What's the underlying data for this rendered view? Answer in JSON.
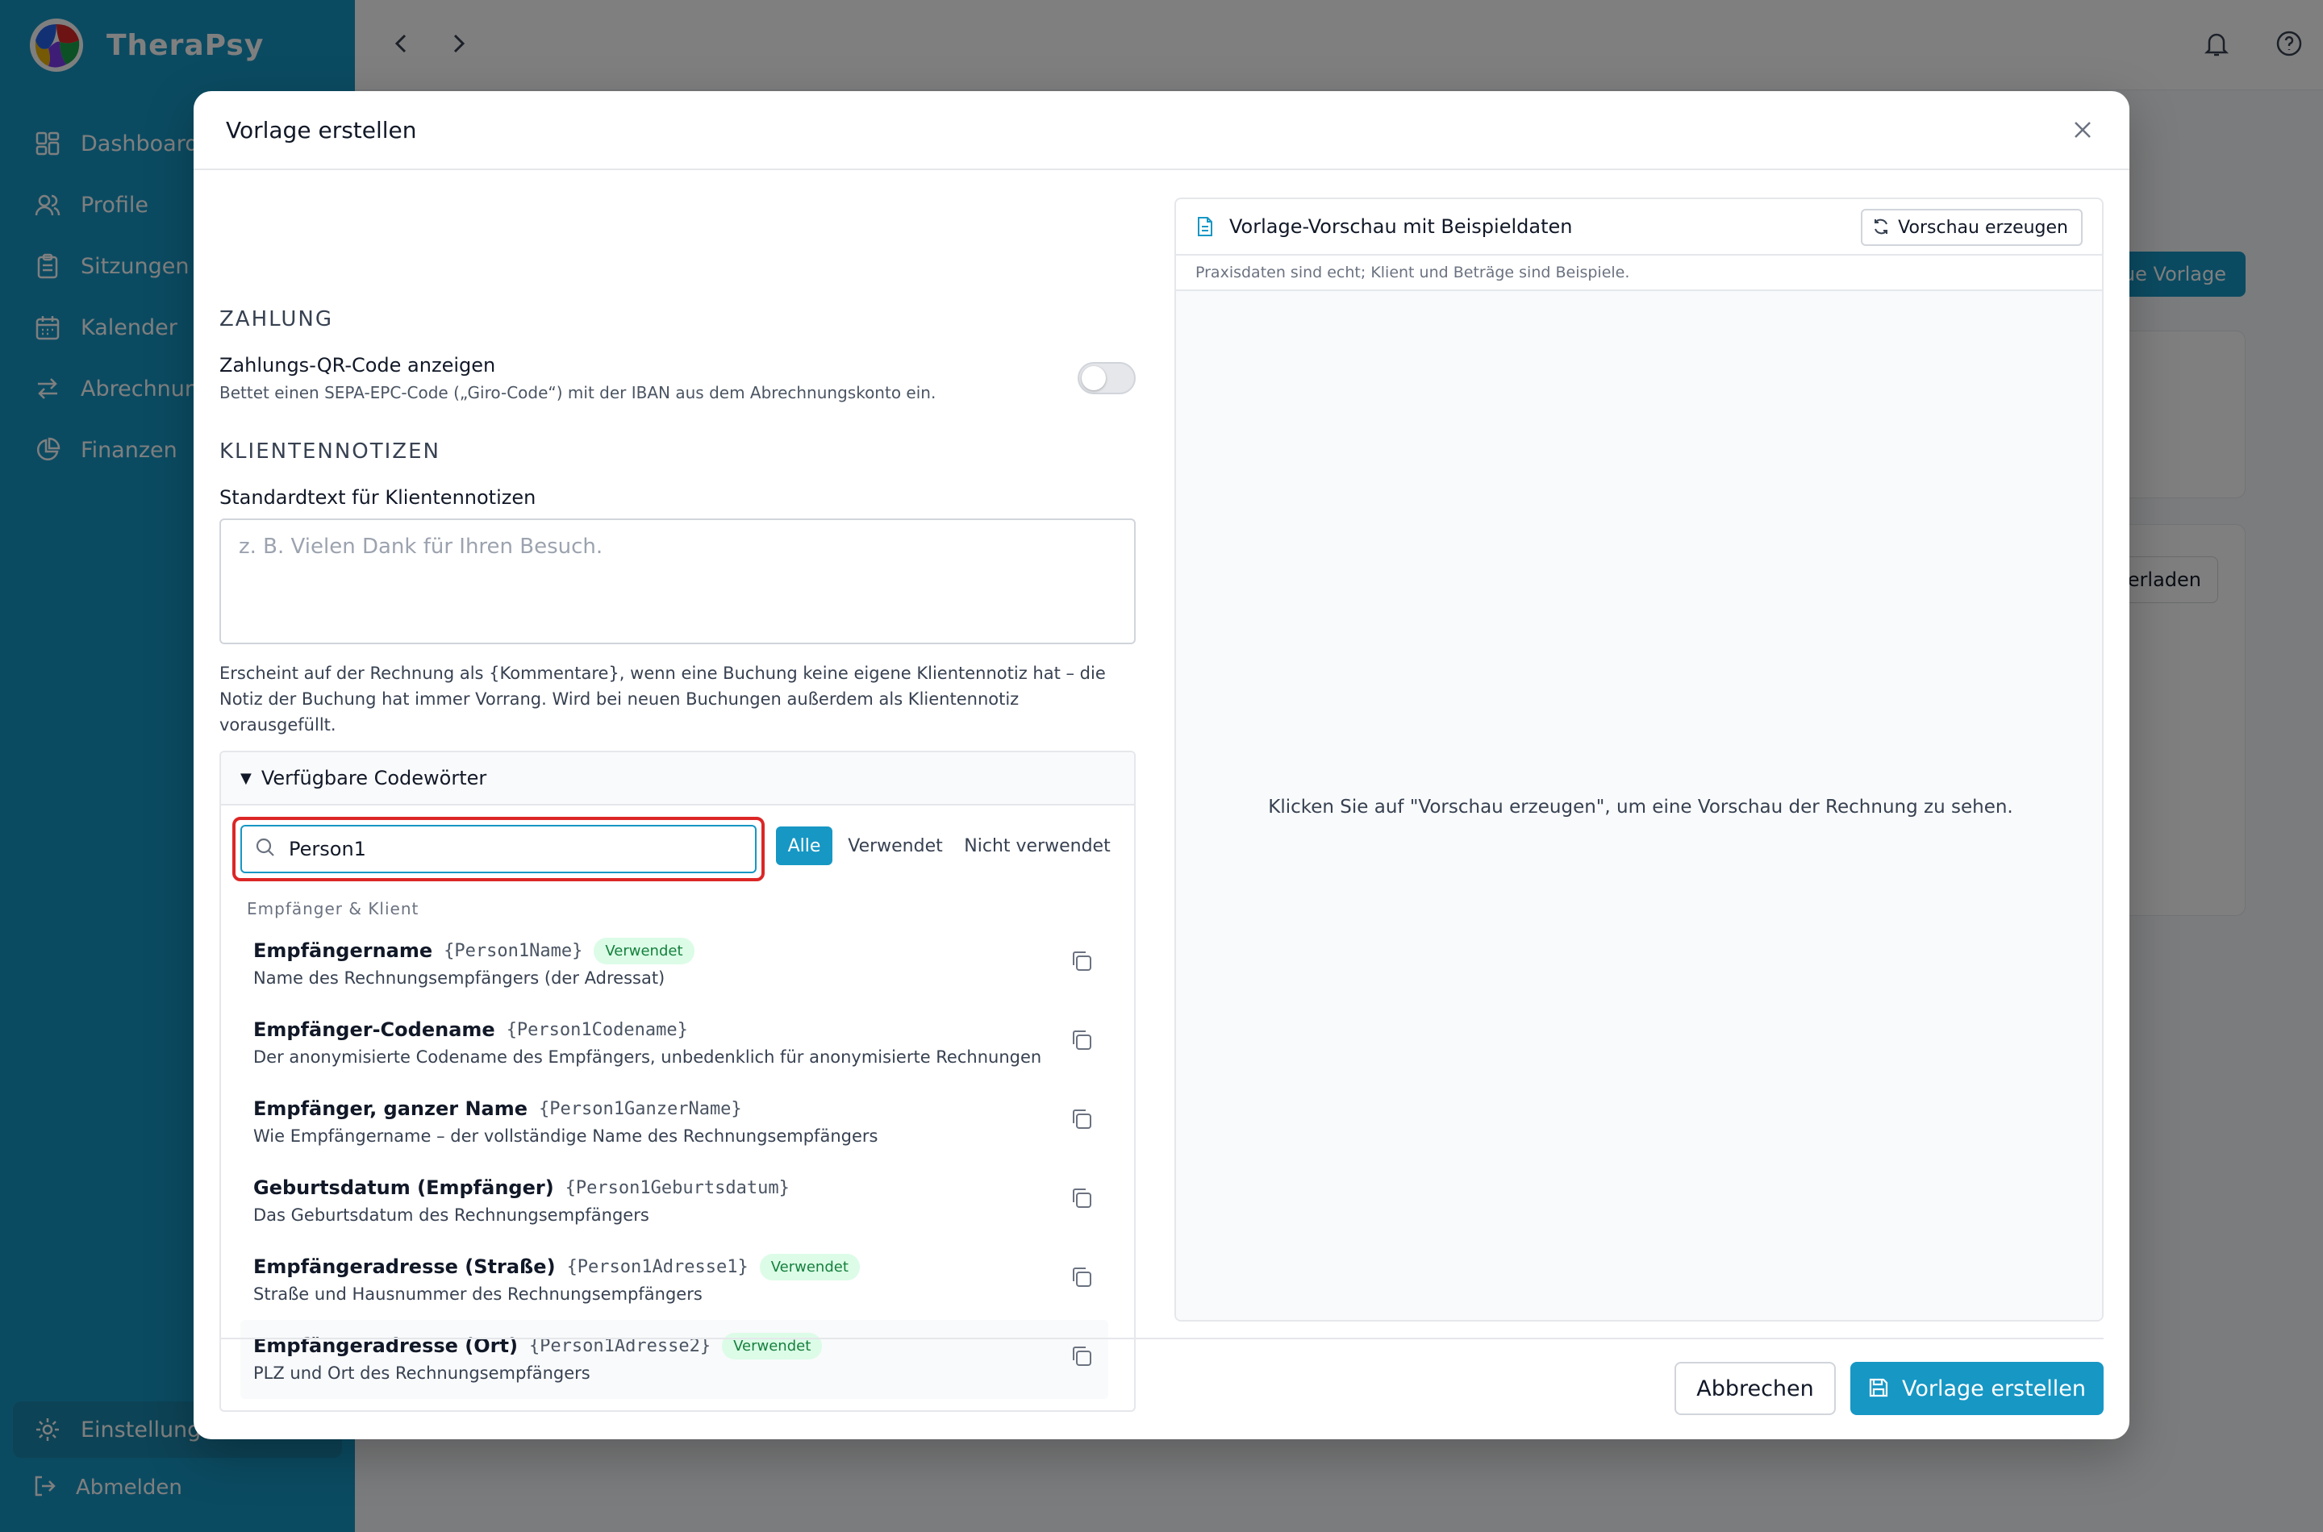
{
  "app": {
    "name": "TheraPsy",
    "nav": [
      {
        "label": "Dashboard",
        "icon": "grid-icon"
      },
      {
        "label": "Profile",
        "icon": "users-icon"
      },
      {
        "label": "Sitzungen",
        "icon": "clipboard-icon"
      },
      {
        "label": "Kalender",
        "icon": "calendar-icon"
      },
      {
        "label": "Abrechnung",
        "icon": "swap-icon"
      },
      {
        "label": "Finanzen",
        "icon": "pie-chart-icon"
      }
    ],
    "settings_label": "Einstellungen",
    "logout_label": "Abmelden",
    "bg_new_button": "Neue Vorlage",
    "bg_download_button": "Herunterladen"
  },
  "modal": {
    "title": "Vorlage erstellen",
    "payment": {
      "section": "Zahlung",
      "qr_label": "Zahlungs-QR-Code anzeigen",
      "qr_desc": "Bettet einen SEPA-EPC-Code („Giro-Code“) mit der IBAN aus dem Abrechnungskonto ein.",
      "qr_enabled": false
    },
    "notes": {
      "section": "Klientennotizen",
      "label": "Standardtext für Klientennotizen",
      "placeholder": "z. B. Vielen Dank für Ihren Besuch.",
      "help": "Erscheint auf der Rechnung als {Kommentare}, wenn eine Buchung keine eigene Klientennotiz hat – die Notiz der Buchung hat immer Vorrang. Wird bei neuen Buchungen außerdem als Klientennotiz vorausgefüllt."
    },
    "codewords": {
      "summary": "Verfügbare Codewörter",
      "search_value": "Person1",
      "filters": [
        "Alle",
        "Verwendet",
        "Nicht verwendet"
      ],
      "active_filter": "Alle",
      "group": "Empfänger & Klient",
      "used_badge": "Verwendet",
      "items": [
        {
          "name": "Empfängername",
          "key": "{Person1Name}",
          "used": true,
          "desc": "Name des Rechnungsempfängers (der Adressat)"
        },
        {
          "name": "Empfänger-Codename",
          "key": "{Person1Codename}",
          "used": false,
          "desc": "Der anonymisierte Codename des Empfängers, unbedenklich für anonymisierte Rechnungen"
        },
        {
          "name": "Empfänger, ganzer Name",
          "key": "{Person1GanzerName}",
          "used": false,
          "desc": "Wie Empfängername – der vollständige Name des Rechnungsempfängers"
        },
        {
          "name": "Geburtsdatum (Empfänger)",
          "key": "{Person1Geburtsdatum}",
          "used": false,
          "desc": "Das Geburtsdatum des Rechnungsempfängers"
        },
        {
          "name": "Empfängeradresse (Straße)",
          "key": "{Person1Adresse1}",
          "used": true,
          "desc": "Straße und Hausnummer des Rechnungsempfängers"
        },
        {
          "name": "Empfängeradresse (Ort)",
          "key": "{Person1Adresse2}",
          "used": true,
          "desc": "PLZ und Ort des Rechnungsempfängers"
        }
      ]
    },
    "preview": {
      "title": "Vorlage-Vorschau mit Beispieldaten",
      "button": "Vorschau erzeugen",
      "subtitle": "Praxisdaten sind echt; Klient und Beträge sind Beispiele.",
      "empty": "Klicken Sie auf \"Vorschau erzeugen\", um eine Vorschau der Rechnung zu sehen."
    },
    "footer": {
      "cancel": "Abbrechen",
      "create": "Vorlage erstellen"
    }
  },
  "colors": {
    "brand": "#1797c4",
    "highlight": "#dc2626",
    "badge_bg": "#dcfce7",
    "badge_text": "#15803d"
  }
}
